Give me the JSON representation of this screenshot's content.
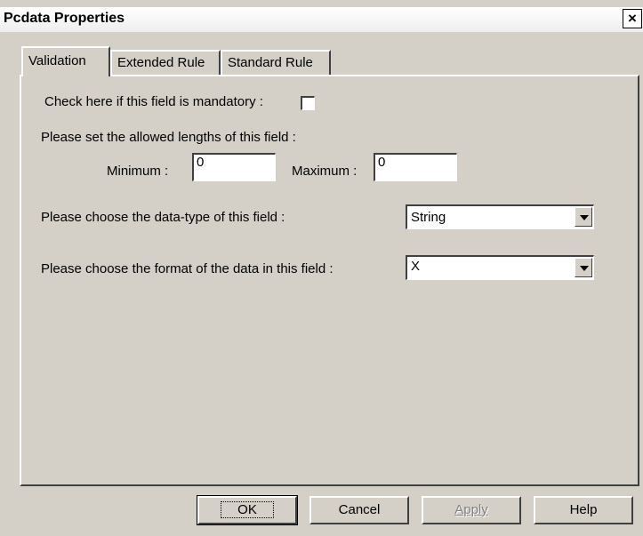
{
  "window": {
    "title": "Pcdata Properties",
    "close_glyph": "×"
  },
  "tabs": [
    {
      "label": "Validation",
      "active": true
    },
    {
      "label": "Extended Rule",
      "active": false
    },
    {
      "label": "Standard Rule",
      "active": false
    }
  ],
  "validation": {
    "mandatory_label": "Check here if this field is mandatory :",
    "mandatory_checked": false,
    "length_label": "Please set the allowed lengths of this field :",
    "minimum_label": "Minimum :",
    "minimum_value": "0",
    "maximum_label": "Maximum :",
    "maximum_value": "0",
    "datatype_label": "Please choose the data-type of this field :",
    "datatype_value": "String",
    "format_label": "Please choose the format of the data in this field :",
    "format_value": "X"
  },
  "buttons": {
    "ok": "OK",
    "cancel": "Cancel",
    "apply": "Apply",
    "help": "Help"
  }
}
